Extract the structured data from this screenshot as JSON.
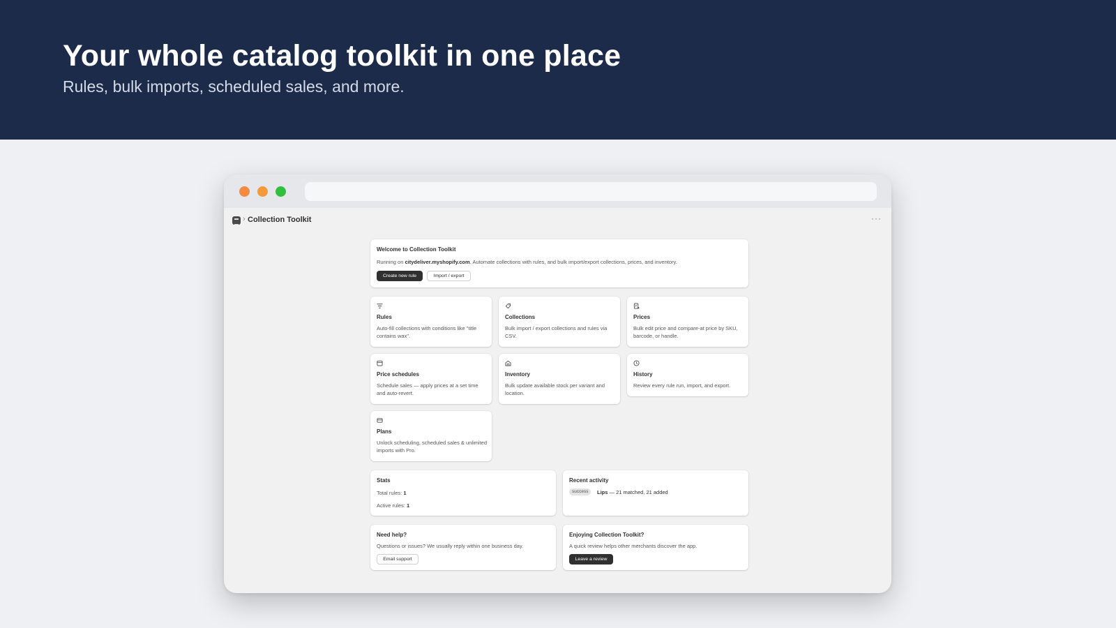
{
  "hero": {
    "title": "Your whole catalog toolkit in one place",
    "subtitle": "Rules, bulk imports, scheduled sales, and more."
  },
  "app": {
    "title": "Collection Toolkit",
    "more": "···"
  },
  "welcome": {
    "title": "Welcome to Collection Toolkit",
    "text_prefix": "Running on ",
    "shop": "citydeliver.myshopify.com",
    "text_suffix": ". Automate collections with rules, and bulk import/export collections, prices, and inventory.",
    "primary_button": "Create new rule",
    "secondary_button": "Import / export"
  },
  "features": [
    {
      "title": "Rules",
      "desc": "Auto-fill collections with conditions like \"title contains wax\".",
      "icon": "filter-icon"
    },
    {
      "title": "Collections",
      "desc": "Bulk import / export collections and rules via CSV.",
      "icon": "tag-icon"
    },
    {
      "title": "Prices",
      "desc": "Bulk edit price and compare-at price by SKU, barcode, or handle.",
      "icon": "price-list-icon"
    },
    {
      "title": "Price schedules",
      "desc": "Schedule sales — apply prices at a set time and auto-revert.",
      "icon": "calendar-icon"
    },
    {
      "title": "Inventory",
      "desc": "Bulk update available stock per variant and location.",
      "icon": "warehouse-icon"
    },
    {
      "title": "History",
      "desc": "Review every rule run, import, and export.",
      "icon": "clock-icon"
    },
    {
      "title": "Plans",
      "desc": "Unlock scheduling, scheduled sales & unlimited imports with Pro.",
      "icon": "credit-card-icon"
    }
  ],
  "stats": {
    "title": "Stats",
    "total_label": "Total rules: ",
    "total_value": "1",
    "active_label": "Active rules: ",
    "active_value": "1"
  },
  "activity": {
    "title": "Recent activity",
    "badge": "success",
    "name": "Lips",
    "detail": " — 21 matched, 21 added"
  },
  "help": {
    "title": "Need help?",
    "text": "Questions or issues? We usually reply within one business day.",
    "button": "Email support"
  },
  "review": {
    "title": "Enjoying Collection Toolkit?",
    "text": "A quick review helps other merchants discover the app.",
    "button": "Leave a review"
  }
}
